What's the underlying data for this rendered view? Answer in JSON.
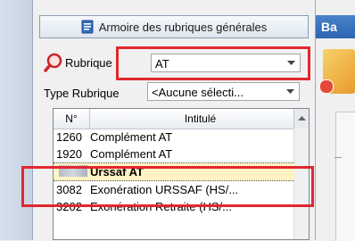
{
  "header": {
    "title": "Armoire des rubriques générales"
  },
  "filters": {
    "rubrique_label": "Rubrique :",
    "rubrique_value": "AT",
    "type_label": "Type Rubrique",
    "type_value": "<Aucune sélecti..."
  },
  "grid": {
    "columns": [
      "N°",
      "Intitulé"
    ],
    "rows": [
      {
        "num": "1260",
        "label": "Complément AT"
      },
      {
        "num": "1920",
        "label": "Complément AT"
      },
      {
        "num": "",
        "label": "Urssaf AT"
      },
      {
        "num": "3082",
        "label": "Exonération URSSAF (HS/..."
      },
      {
        "num": "3202",
        "label": "Exonération Retraite (HS/..."
      }
    ]
  },
  "right_panel": {
    "tab_label": "Ba"
  },
  "colors": {
    "highlight_red": "#e0282f",
    "selected_row": "#fff3c4",
    "tab_blue": "#2c64b1"
  },
  "icons": [
    "document-icon",
    "magnifier-icon",
    "dropdown-arrow-icon",
    "scroll-up-arrow-icon",
    "app-tile-icon"
  ]
}
